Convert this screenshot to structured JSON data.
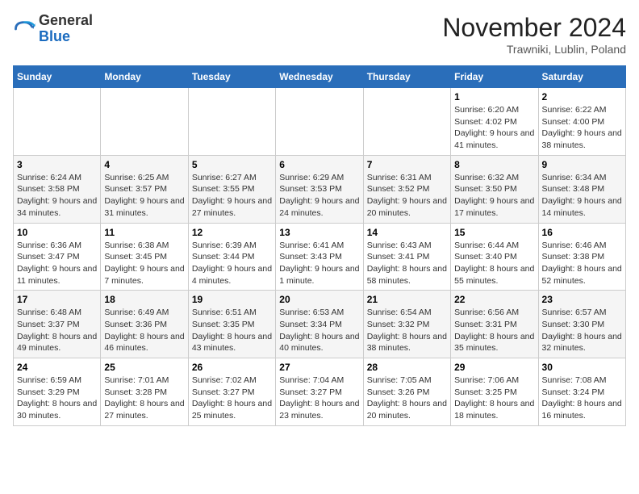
{
  "header": {
    "logo_general": "General",
    "logo_blue": "Blue",
    "month_title": "November 2024",
    "location": "Trawniki, Lublin, Poland"
  },
  "days_of_week": [
    "Sunday",
    "Monday",
    "Tuesday",
    "Wednesday",
    "Thursday",
    "Friday",
    "Saturday"
  ],
  "weeks": [
    [
      {
        "day": "",
        "info": ""
      },
      {
        "day": "",
        "info": ""
      },
      {
        "day": "",
        "info": ""
      },
      {
        "day": "",
        "info": ""
      },
      {
        "day": "",
        "info": ""
      },
      {
        "day": "1",
        "info": "Sunrise: 6:20 AM\nSunset: 4:02 PM\nDaylight: 9 hours and 41 minutes."
      },
      {
        "day": "2",
        "info": "Sunrise: 6:22 AM\nSunset: 4:00 PM\nDaylight: 9 hours and 38 minutes."
      }
    ],
    [
      {
        "day": "3",
        "info": "Sunrise: 6:24 AM\nSunset: 3:58 PM\nDaylight: 9 hours and 34 minutes."
      },
      {
        "day": "4",
        "info": "Sunrise: 6:25 AM\nSunset: 3:57 PM\nDaylight: 9 hours and 31 minutes."
      },
      {
        "day": "5",
        "info": "Sunrise: 6:27 AM\nSunset: 3:55 PM\nDaylight: 9 hours and 27 minutes."
      },
      {
        "day": "6",
        "info": "Sunrise: 6:29 AM\nSunset: 3:53 PM\nDaylight: 9 hours and 24 minutes."
      },
      {
        "day": "7",
        "info": "Sunrise: 6:31 AM\nSunset: 3:52 PM\nDaylight: 9 hours and 20 minutes."
      },
      {
        "day": "8",
        "info": "Sunrise: 6:32 AM\nSunset: 3:50 PM\nDaylight: 9 hours and 17 minutes."
      },
      {
        "day": "9",
        "info": "Sunrise: 6:34 AM\nSunset: 3:48 PM\nDaylight: 9 hours and 14 minutes."
      }
    ],
    [
      {
        "day": "10",
        "info": "Sunrise: 6:36 AM\nSunset: 3:47 PM\nDaylight: 9 hours and 11 minutes."
      },
      {
        "day": "11",
        "info": "Sunrise: 6:38 AM\nSunset: 3:45 PM\nDaylight: 9 hours and 7 minutes."
      },
      {
        "day": "12",
        "info": "Sunrise: 6:39 AM\nSunset: 3:44 PM\nDaylight: 9 hours and 4 minutes."
      },
      {
        "day": "13",
        "info": "Sunrise: 6:41 AM\nSunset: 3:43 PM\nDaylight: 9 hours and 1 minute."
      },
      {
        "day": "14",
        "info": "Sunrise: 6:43 AM\nSunset: 3:41 PM\nDaylight: 8 hours and 58 minutes."
      },
      {
        "day": "15",
        "info": "Sunrise: 6:44 AM\nSunset: 3:40 PM\nDaylight: 8 hours and 55 minutes."
      },
      {
        "day": "16",
        "info": "Sunrise: 6:46 AM\nSunset: 3:38 PM\nDaylight: 8 hours and 52 minutes."
      }
    ],
    [
      {
        "day": "17",
        "info": "Sunrise: 6:48 AM\nSunset: 3:37 PM\nDaylight: 8 hours and 49 minutes."
      },
      {
        "day": "18",
        "info": "Sunrise: 6:49 AM\nSunset: 3:36 PM\nDaylight: 8 hours and 46 minutes."
      },
      {
        "day": "19",
        "info": "Sunrise: 6:51 AM\nSunset: 3:35 PM\nDaylight: 8 hours and 43 minutes."
      },
      {
        "day": "20",
        "info": "Sunrise: 6:53 AM\nSunset: 3:34 PM\nDaylight: 8 hours and 40 minutes."
      },
      {
        "day": "21",
        "info": "Sunrise: 6:54 AM\nSunset: 3:32 PM\nDaylight: 8 hours and 38 minutes."
      },
      {
        "day": "22",
        "info": "Sunrise: 6:56 AM\nSunset: 3:31 PM\nDaylight: 8 hours and 35 minutes."
      },
      {
        "day": "23",
        "info": "Sunrise: 6:57 AM\nSunset: 3:30 PM\nDaylight: 8 hours and 32 minutes."
      }
    ],
    [
      {
        "day": "24",
        "info": "Sunrise: 6:59 AM\nSunset: 3:29 PM\nDaylight: 8 hours and 30 minutes."
      },
      {
        "day": "25",
        "info": "Sunrise: 7:01 AM\nSunset: 3:28 PM\nDaylight: 8 hours and 27 minutes."
      },
      {
        "day": "26",
        "info": "Sunrise: 7:02 AM\nSunset: 3:27 PM\nDaylight: 8 hours and 25 minutes."
      },
      {
        "day": "27",
        "info": "Sunrise: 7:04 AM\nSunset: 3:27 PM\nDaylight: 8 hours and 23 minutes."
      },
      {
        "day": "28",
        "info": "Sunrise: 7:05 AM\nSunset: 3:26 PM\nDaylight: 8 hours and 20 minutes."
      },
      {
        "day": "29",
        "info": "Sunrise: 7:06 AM\nSunset: 3:25 PM\nDaylight: 8 hours and 18 minutes."
      },
      {
        "day": "30",
        "info": "Sunrise: 7:08 AM\nSunset: 3:24 PM\nDaylight: 8 hours and 16 minutes."
      }
    ]
  ]
}
